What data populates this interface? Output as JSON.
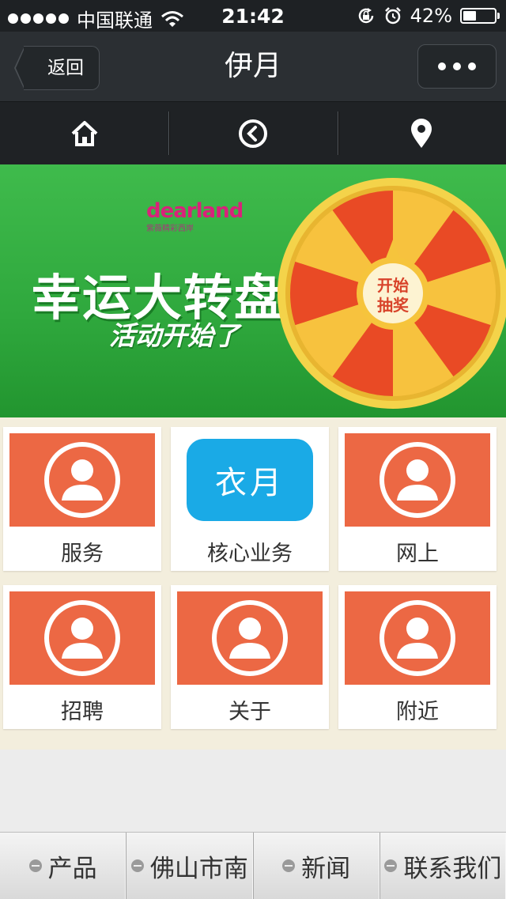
{
  "status_bar": {
    "carrier": "中国联通",
    "time": "21:42",
    "battery": "42%",
    "battery_level": 0.42
  },
  "navbar": {
    "back_label": "返回",
    "title": "伊月",
    "more_icon": "more-dots-icon"
  },
  "toolbar": {
    "items": [
      {
        "icon": "home-icon"
      },
      {
        "icon": "back-circle-icon"
      },
      {
        "icon": "location-pin-icon"
      }
    ]
  },
  "banner": {
    "brand": "dearland",
    "brand_sub": "紫薇精彩西岸",
    "headline": "幸运大转盘",
    "subline": "活动开始了",
    "wheel_center": "开始抽奖",
    "colors": {
      "background": "#35b043",
      "wheel_red": "#e94a25",
      "wheel_gold": "#f7c23e"
    }
  },
  "grid": {
    "tiles": [
      {
        "label": "服务",
        "image": "person-placeholder"
      },
      {
        "label": "核心业务",
        "image": "brand-logo",
        "logo_text": "衣月"
      },
      {
        "label": "网上",
        "image": "person-placeholder"
      },
      {
        "label": "招聘",
        "image": "person-placeholder"
      },
      {
        "label": "关于",
        "image": "person-placeholder"
      },
      {
        "label": "附近",
        "image": "person-placeholder"
      }
    ],
    "colors": {
      "tile_image": "#ec6844",
      "logo": "#1aaae6",
      "background": "#f3eedd"
    }
  },
  "footer": {
    "tabs": [
      {
        "label": "产品"
      },
      {
        "label": "佛山市南"
      },
      {
        "label": "新闻"
      },
      {
        "label": "联系我们"
      }
    ]
  }
}
